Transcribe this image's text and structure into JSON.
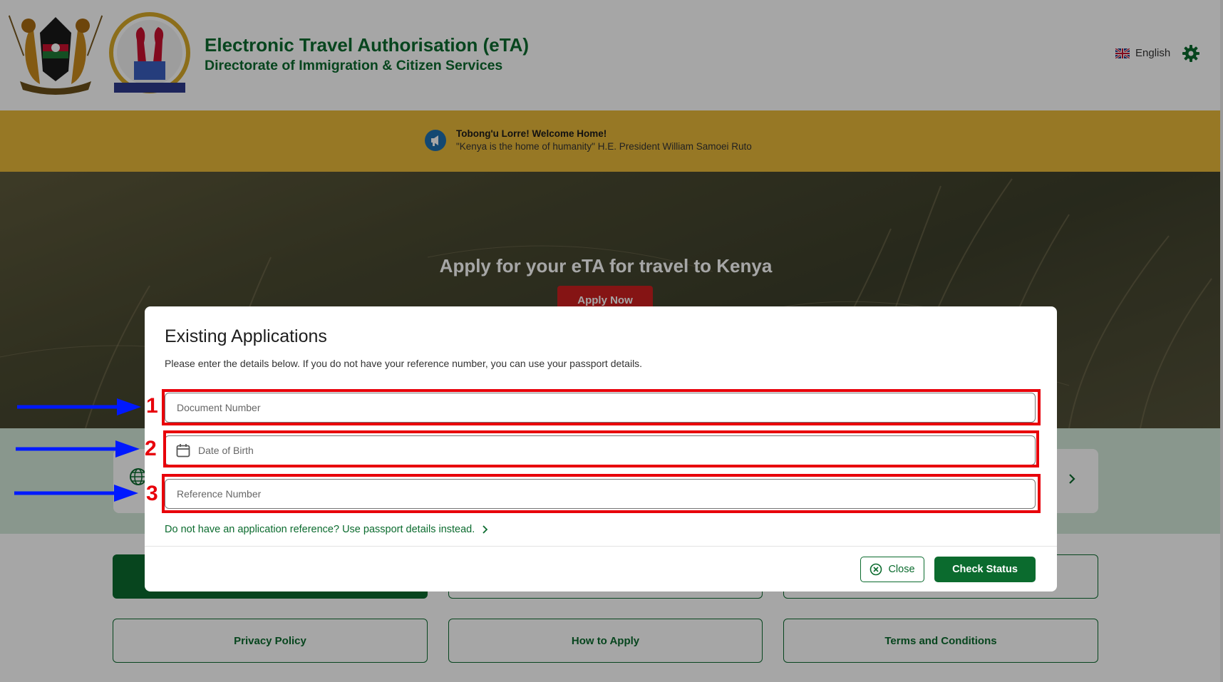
{
  "header": {
    "title": "Electronic Travel Authorisation (eTA)",
    "subtitle": "Directorate of Immigration & Citizen Services",
    "language_label": "English",
    "settings_icon": "gear-icon",
    "flag_icon": "uk-flag-icon"
  },
  "banner": {
    "title": "Tobong'u Lorre! Welcome Home!",
    "quote": "\"Kenya is the home of humanity\" H.E. President William Samoei Ruto",
    "icon": "megaphone-icon"
  },
  "hero": {
    "title": "Apply for your eTA for travel to Kenya",
    "apply_button": "Apply Now"
  },
  "links": {
    "privacy": "Privacy Policy",
    "how_to_apply": "How to Apply",
    "terms": "Terms and Conditions"
  },
  "modal": {
    "title": "Existing Applications",
    "description": "Please enter the details below. If you do not have your reference number, you can use your passport details.",
    "fields": {
      "document_number": {
        "placeholder": "Document Number"
      },
      "date_of_birth": {
        "placeholder": "Date of Birth"
      },
      "reference_number": {
        "placeholder": "Reference Number"
      }
    },
    "alt_link": "Do not have an application reference? Use passport details instead.",
    "close_label": "Close",
    "check_status_label": "Check Status"
  },
  "annotations": {
    "markers": [
      "1",
      "2",
      "3"
    ],
    "box_color": "#e8000a",
    "arrow_color": "#0019ff"
  },
  "colors": {
    "brand_green": "#0b6b2e",
    "banner_gold": "#e9b93a",
    "apply_red": "#cc1f1f"
  }
}
